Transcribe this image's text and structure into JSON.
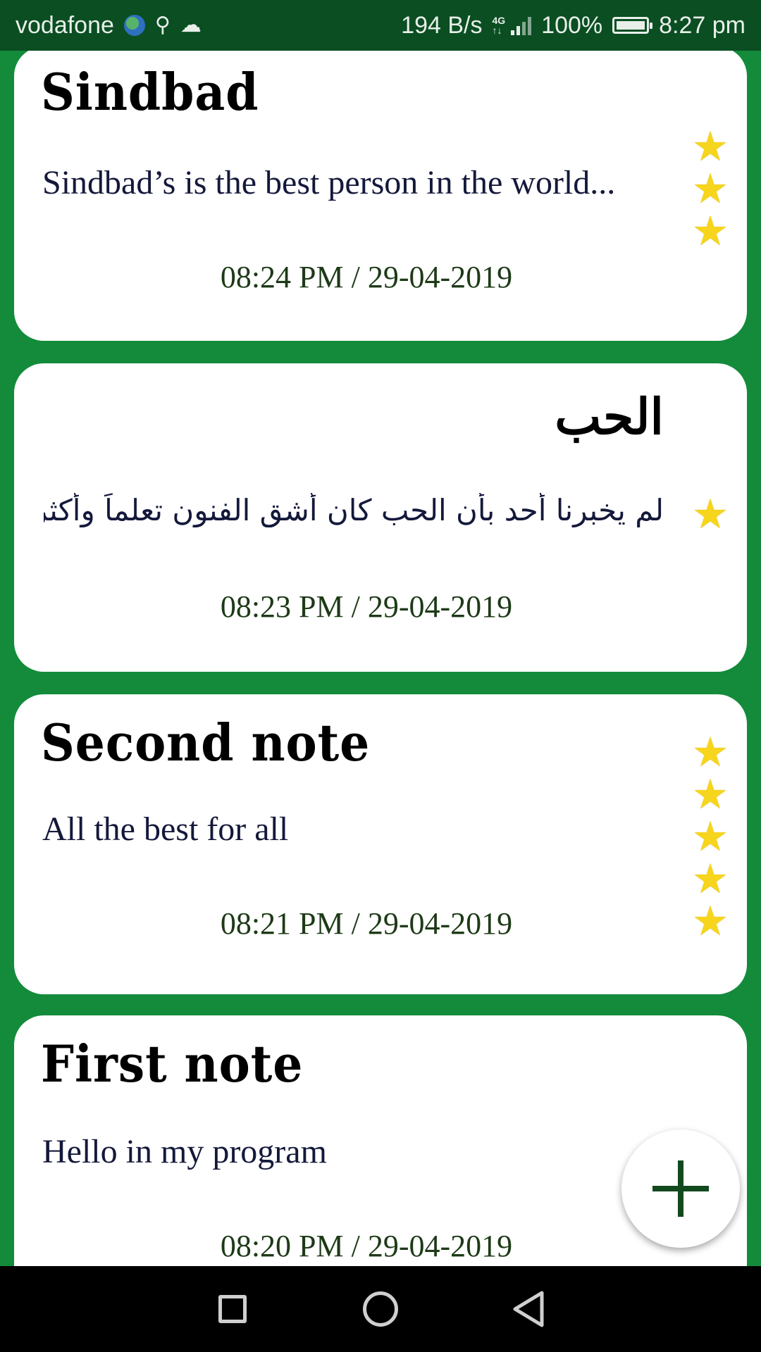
{
  "status_bar": {
    "carrier": "vodafone",
    "net_speed": "194 B/s",
    "net_gen_top": "4G",
    "net_gen_bottom": "↑↓",
    "battery": "100%",
    "time": "8:27 pm"
  },
  "notes": [
    {
      "title": "Sindbad",
      "body": "Sindbad’s is the best person in the world...",
      "date": "08:24 PM / 29-04-2019",
      "stars": 3
    },
    {
      "title": "الحب",
      "body": "لم يخبرنا أحد بأن الحب كان أشق الفنون تعلماً وأكثرها تأ...",
      "date": "08:23 PM / 29-04-2019",
      "stars": 1
    },
    {
      "title": "Second  note",
      "body": "All the best for all",
      "date": "08:21 PM / 29-04-2019",
      "stars": 5
    },
    {
      "title": "First  note",
      "body": "Hello in my program",
      "date": "08:20 PM / 29-04-2019",
      "stars": 0
    }
  ],
  "icons": {
    "star": "★",
    "fab": "plus-icon",
    "usb": "usb-icon",
    "cloud": "cloud-icon"
  },
  "colors": {
    "background": "#138b3b",
    "status_bar": "#0a4e22",
    "star": "#f6d51c",
    "fab_plus": "#12491f"
  }
}
